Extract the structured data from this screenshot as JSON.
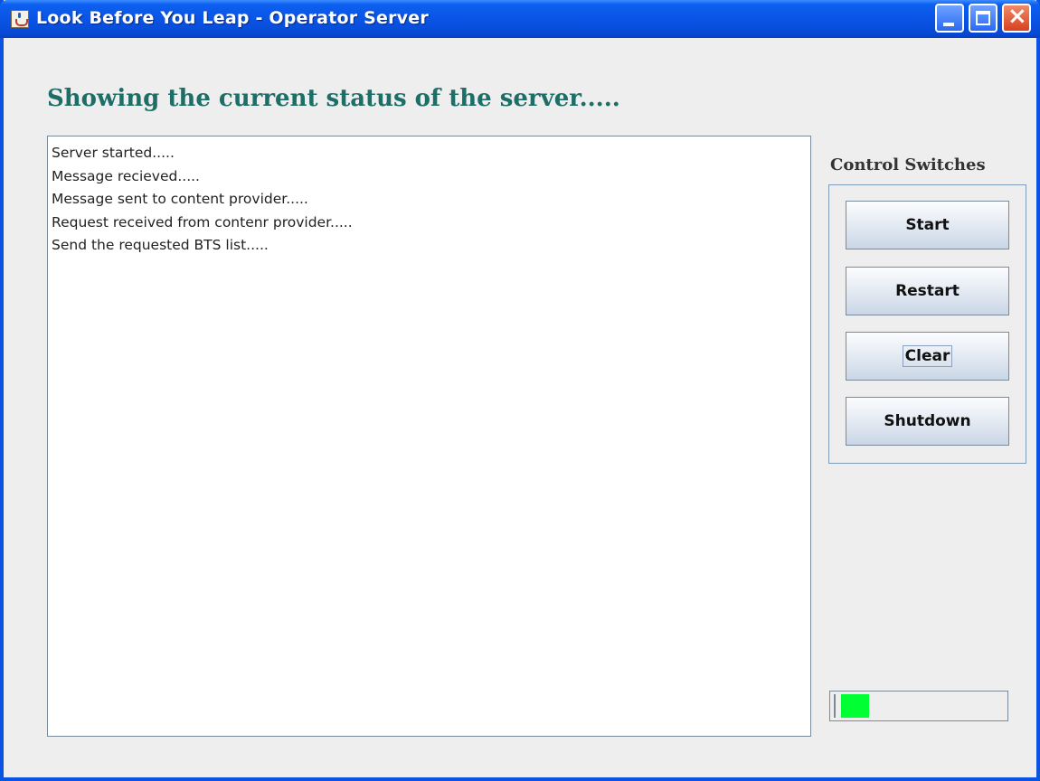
{
  "window": {
    "title": "Look Before You Leap - Operator Server"
  },
  "main": {
    "heading": "Showing the current status of the server.....",
    "log_lines": [
      "Server started.....",
      "Message recieved.....",
      "Message sent to content provider.....",
      "Request received from contenr provider.....",
      "Send the requested BTS list....."
    ]
  },
  "controls": {
    "label": "Control Switches",
    "start_label": "Start",
    "restart_label": "Restart",
    "clear_label": "Clear",
    "shutdown_label": "Shutdown"
  },
  "progress": {
    "fraction": 0.17,
    "fill_color": "#00ff33"
  },
  "colors": {
    "titlebar": "#0a54e6",
    "heading": "#1e6e68",
    "background": "#eeeeee"
  },
  "icons": {
    "app": "java-app-icon",
    "minimize": "minimize-icon",
    "maximize": "maximize-icon",
    "close": "close-icon"
  }
}
